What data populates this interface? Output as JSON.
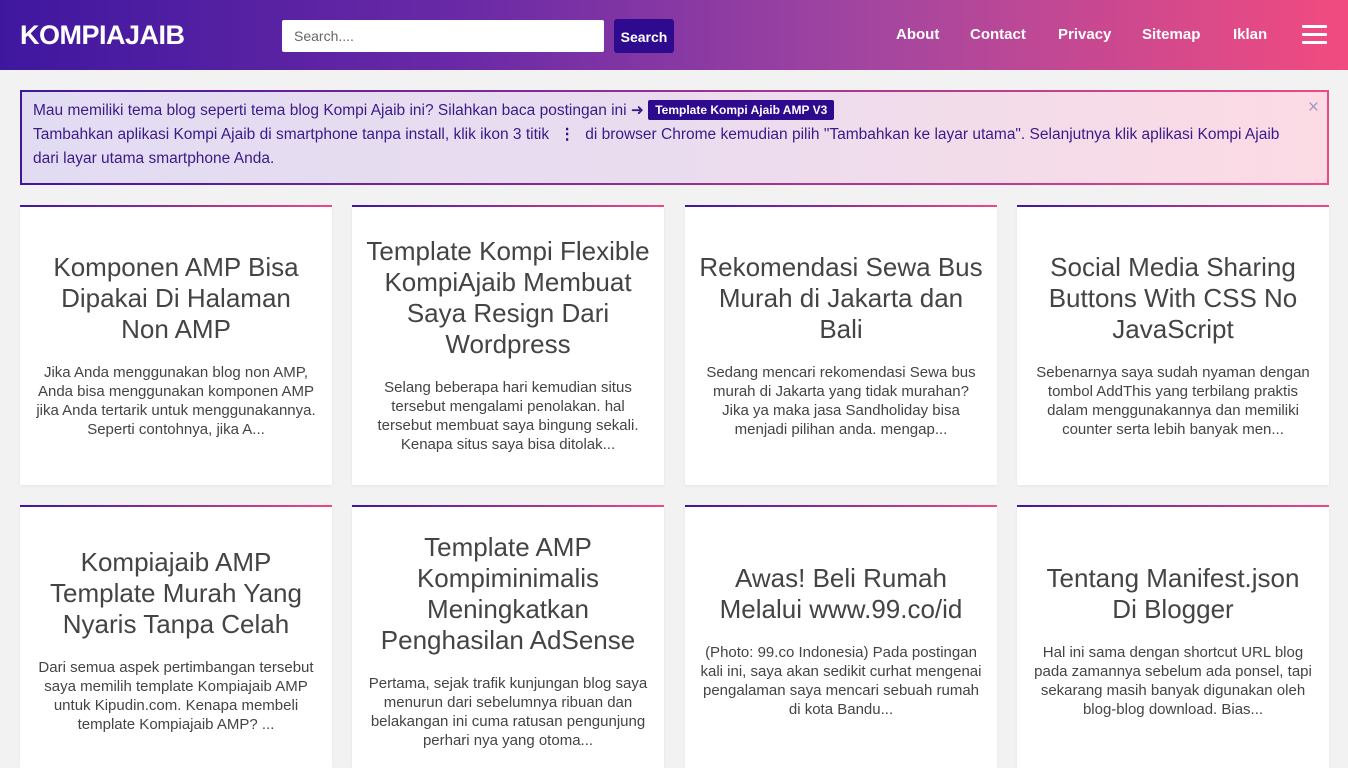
{
  "header": {
    "logo": "KOMPIAJAIB",
    "search_placeholder": "Search....",
    "search_button": "Search",
    "nav": [
      "About",
      "Contact",
      "Privacy",
      "Sitemap",
      "Iklan"
    ],
    "menu_icon": "hamburger-icon"
  },
  "notice": {
    "line1": "Mau memiliki tema blog seperti tema blog Kompi Ajaib ini? Silahkan baca postingan ini ➜",
    "tag": "Template Kompi Ajaib AMP V3",
    "line2_before": "Tambahkan aplikasi Kompi Ajaib di smartphone tanpa install, klik ikon 3 titik",
    "dots": "⋮",
    "line2_after": "di browser Chrome kemudian pilih \"Tambahkan ke layar utama\". Selanjutnya klik aplikasi Kompi Ajaib dari layar utama smartphone Anda.",
    "close": "×"
  },
  "posts": [
    {
      "title": "Komponen AMP Bisa Dipakai Di Halaman Non AMP",
      "excerpt": "Jika Anda menggunakan blog non AMP, Anda bisa menggunakan komponen AMP jika Anda tertarik untuk menggunakannya. Seperti contohnya, jika A..."
    },
    {
      "title": "Template Kompi Flexible KompiAjaib Membuat Saya Resign Dari Wordpress",
      "excerpt": "Selang beberapa hari kemudian situs tersebut mengalami penolakan. hal tersebut membuat saya bingung sekali. Kenapa situs saya bisa ditolak..."
    },
    {
      "title": "Rekomendasi Sewa Bus Murah di Jakarta dan Bali",
      "excerpt": "Sedang mencari rekomendasi Sewa bus murah di Jakarta yang tidak murahan? Jika ya maka jasa Sandholiday bisa menjadi pilihan anda. mengap..."
    },
    {
      "title": "Social Media Sharing Buttons With CSS No JavaScript",
      "excerpt": "Sebenarnya saya sudah nyaman dengan tombol AddThis yang terbilang praktis dalam menggunakannya dan memiliki counter serta lebih banyak men..."
    },
    {
      "title": "Kompiajaib AMP Template Murah Yang Nyaris Tanpa Celah",
      "excerpt": "Dari semua aspek pertimbangan tersebut saya memilih template Kompiajaib AMP untuk Kipudin.com. Kenapa membeli template Kompiajaib AMP? ..."
    },
    {
      "title": "Template AMP Kompiminimalis Meningkatkan Penghasilan AdSense",
      "excerpt": "Pertama, sejak trafik kunjungan blog saya menurun dari sebelumnya ribuan dan belakangan ini cuma ratusan pengunjung perhari nya yang otoma..."
    },
    {
      "title": "Awas! Beli Rumah Melalui www.99.co/id",
      "excerpt": "(Photo: 99.co Indonesia) Pada postingan kali ini, saya akan sedikit curhat mengenai pengalaman saya mencari sebuah rumah di kota Bandu..."
    },
    {
      "title": "Tentang Manifest.json Di Blogger",
      "excerpt": "Hal ini sama dengan shortcut URL blog pada zamannya sebelum ada ponsel, tapi sekarang masih banyak digunakan oleh blog-blog download. Bias..."
    }
  ]
}
